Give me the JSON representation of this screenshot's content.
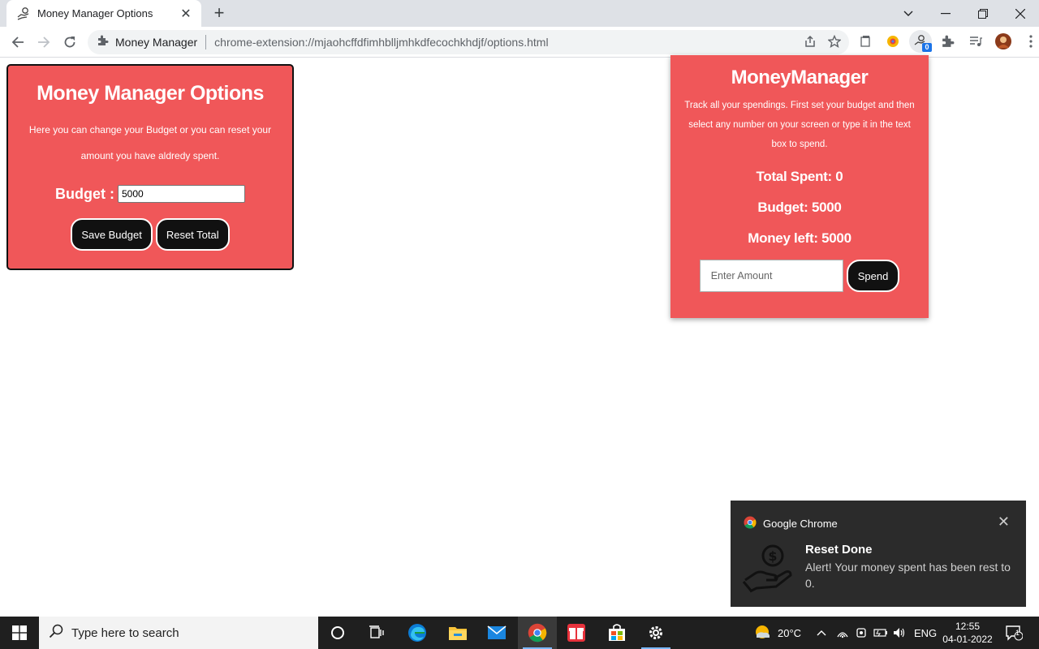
{
  "browser": {
    "tab_title": "Money Manager Options",
    "site_label": "Money Manager",
    "url": "chrome-extension://mjaohcffdfimhblljmhkdfecochkhdjf/options.html",
    "extension_badge": "0"
  },
  "options": {
    "title": "Money Manager Options",
    "description": "Here you can change your Budget or you can reset your amount you have aldredy spent.",
    "budget_label": "Budget :",
    "budget_value": "5000",
    "save_label": "Save Budget",
    "reset_label": "Reset Total"
  },
  "popup": {
    "title": "MoneyManager",
    "description": "Track all your spendings. First set your budget and then select any number on your screen or type it in the text box to spend.",
    "total_spent": "Total Spent: 0",
    "budget": "Budget: 5000",
    "money_left": "Money left: 5000",
    "amount_placeholder": "Enter Amount",
    "spend_label": "Spend"
  },
  "notification": {
    "app": "Google Chrome",
    "title": "Reset Done",
    "body": "Alert! Your money spent has been rest to 0."
  },
  "taskbar": {
    "search_placeholder": "Type here to search",
    "weather": "20°C",
    "language": "ENG",
    "time": "12:55",
    "date": "04-01-2022",
    "notification_count": "1"
  },
  "colors": {
    "card": "#f05759",
    "button": "#111111",
    "toast": "#2b2b2b",
    "taskbar": "#1f1f1f"
  }
}
